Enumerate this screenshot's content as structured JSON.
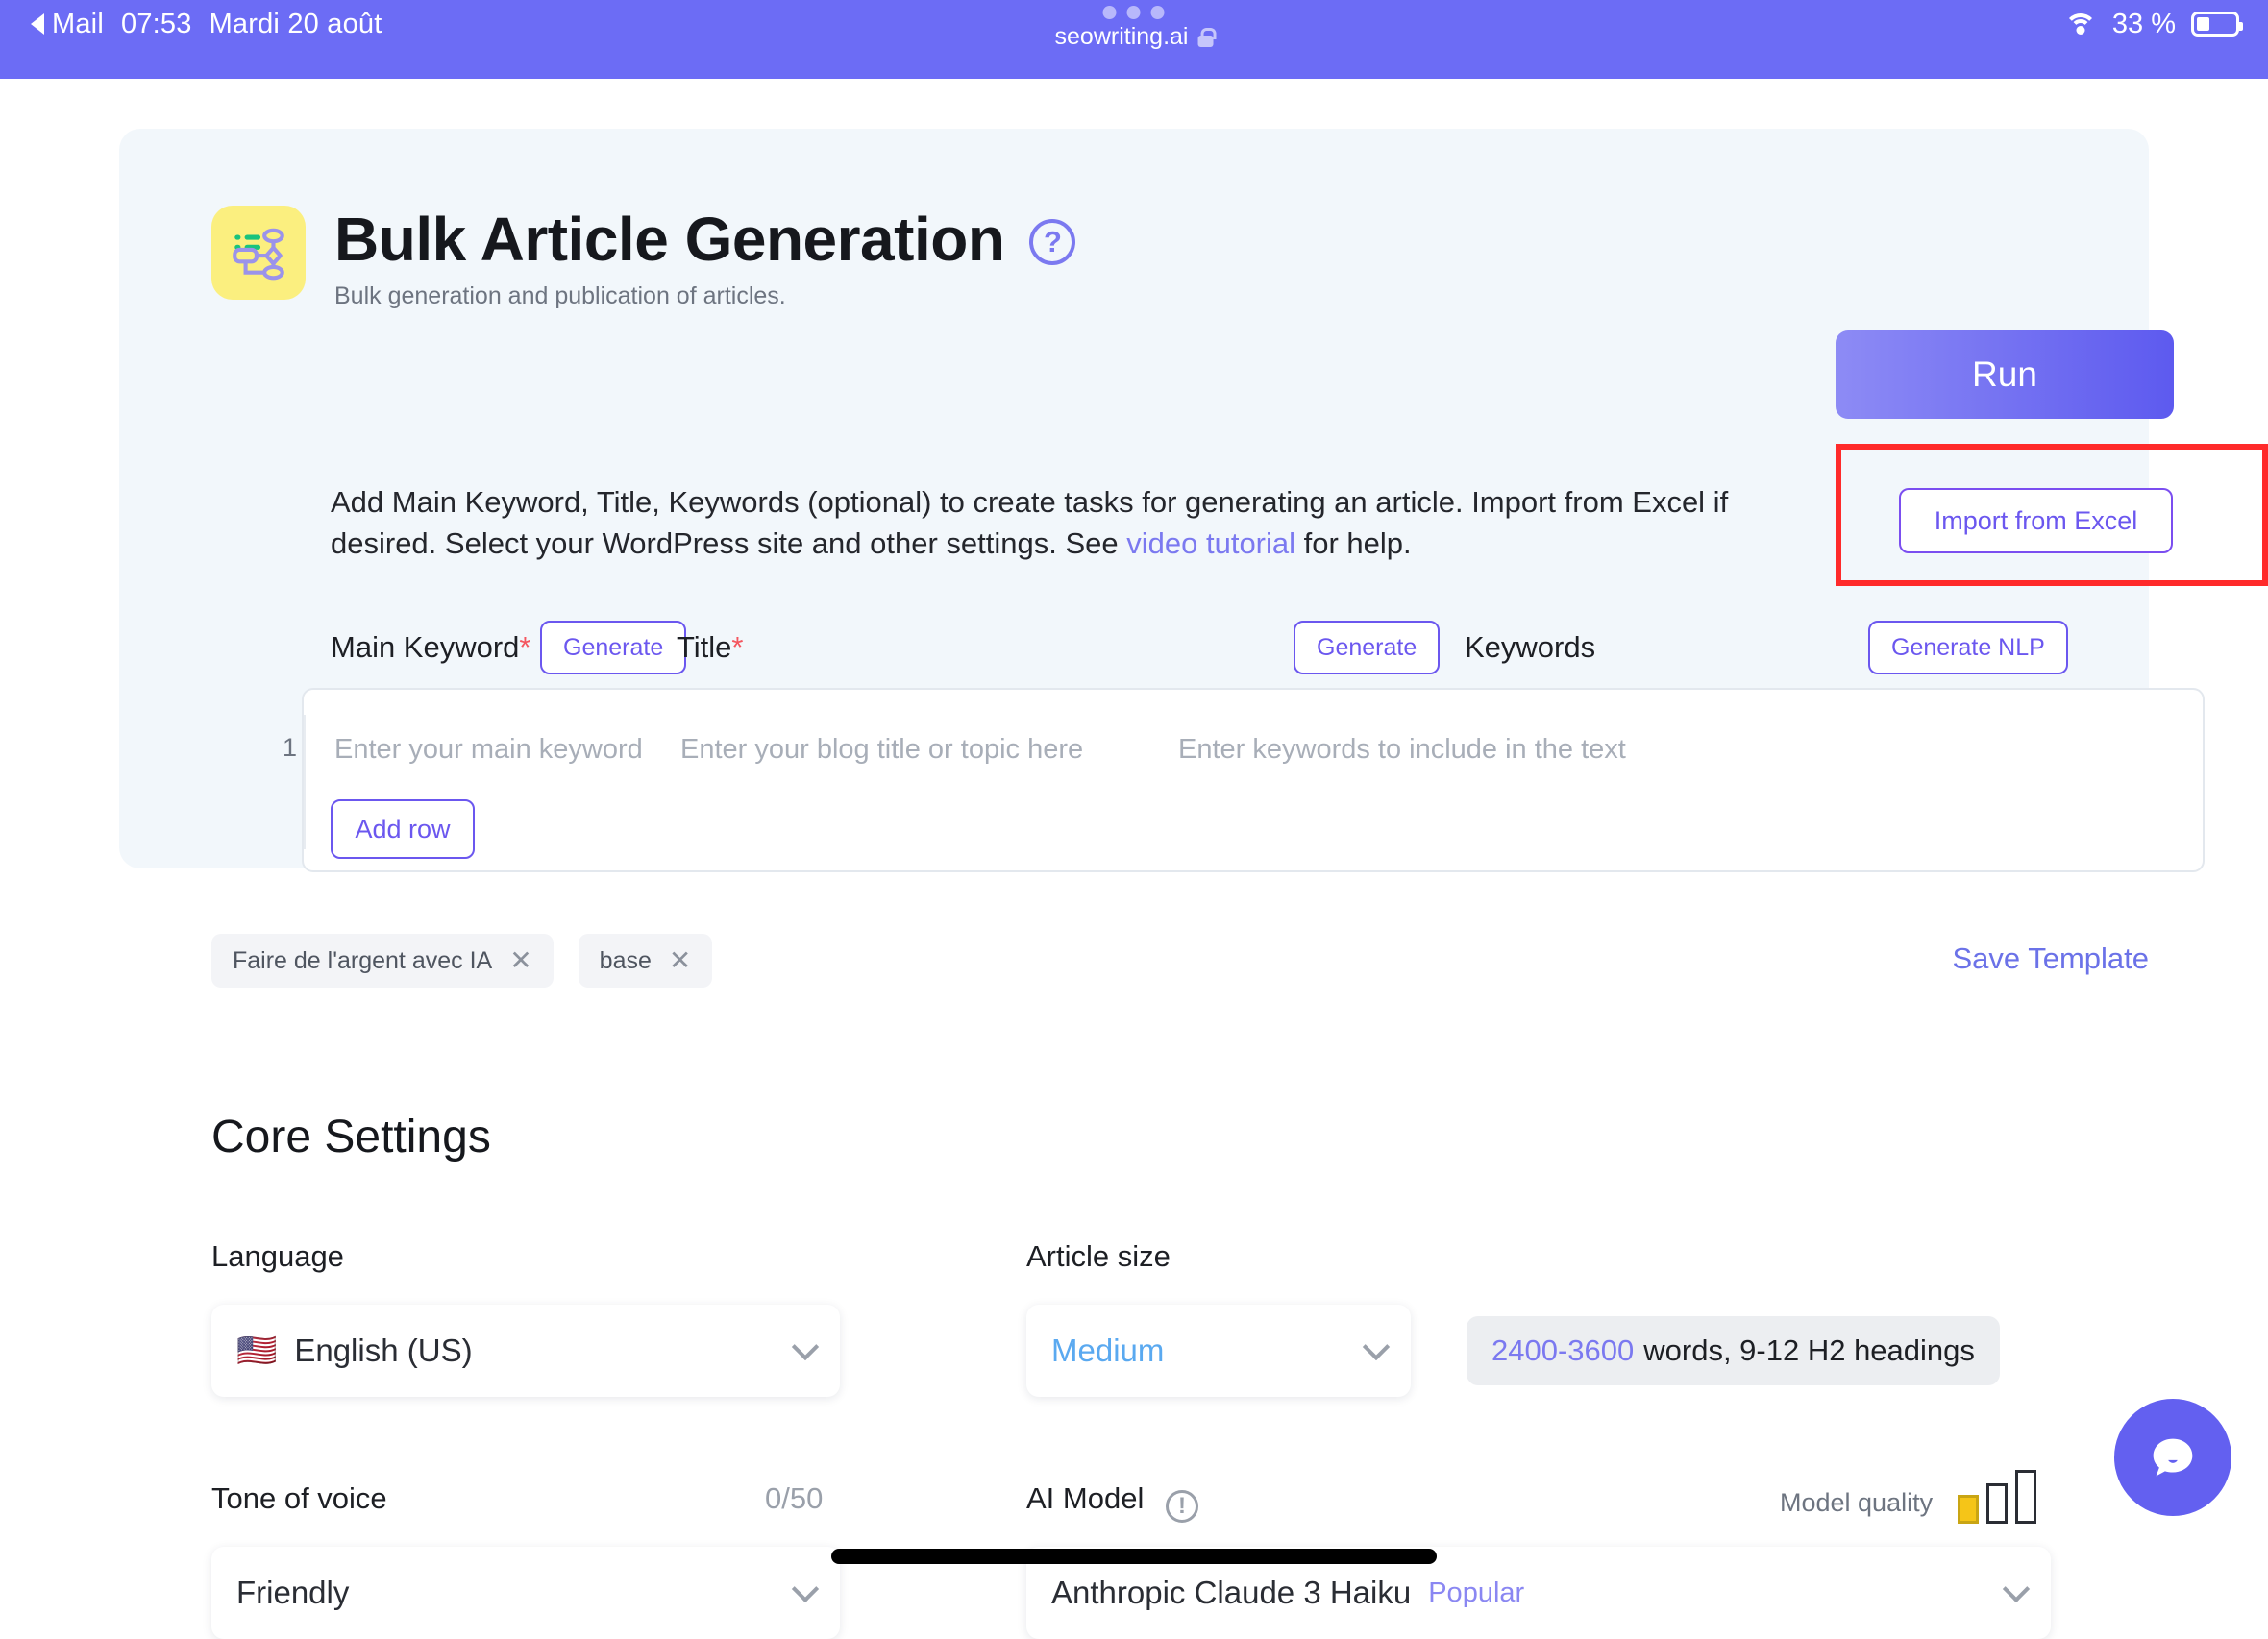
{
  "statusbar": {
    "back_app": "Mail",
    "time": "07:53",
    "date": "Mardi 20 août",
    "url": "seowriting.ai",
    "battery_percent": "33 %",
    "battery_level": 33,
    "accent": "#6c6cf5"
  },
  "hero": {
    "title": "Bulk Article Generation",
    "subtitle": "Bulk generation and publication of articles.",
    "description_part1": "Add Main Keyword, Title, Keywords (optional) to create tasks for generating an article. Import from Excel if desired. Select your WordPress site and other settings. See ",
    "description_link": "video tutorial",
    "description_part2": " for help.",
    "run_label": "Run",
    "import_label": "Import from Excel",
    "highlight_color": "#ff2a2a",
    "run_gradient_from": "#8d8bf5",
    "run_gradient_to": "#5d5aef"
  },
  "form": {
    "main_keyword_label": "Main Keyword",
    "title_label": "Title",
    "keywords_label": "Keywords",
    "required_mark": "*",
    "generate_keyword_label": "Generate",
    "generate_title_label": "Generate",
    "generate_nlp_label": "Generate NLP",
    "row_number": "1",
    "main_keyword_placeholder": "Enter your main keyword",
    "title_placeholder": "Enter your blog title or topic here",
    "keywords_placeholder": "Enter keywords to include in the text",
    "add_row_label": "Add row"
  },
  "tags": [
    {
      "label": "Faire de l'argent avec IA",
      "close": "✕"
    },
    {
      "label": "base",
      "close": "✕"
    }
  ],
  "save_template_label": "Save Template",
  "core_settings": {
    "heading": "Core Settings",
    "language_label": "Language",
    "language_value": "English (US)",
    "language_flag": "🇺🇸",
    "article_size_label": "Article size",
    "article_size_value": "Medium",
    "article_size_info_range": "2400-3600",
    "article_size_info_rest": "words, 9-12 H2 headings",
    "tone_label": "Tone of voice",
    "tone_counter": "0/50",
    "tone_value": "Friendly",
    "ai_model_label": "AI Model",
    "ai_model_value": "Anthropic Claude 3 Haiku",
    "ai_model_badge": "Popular",
    "model_quality_label": "Model quality",
    "model_quality_level": 1,
    "quality_fill_color": "#f5c518"
  },
  "chat_widget": {
    "name": "chat-support"
  }
}
